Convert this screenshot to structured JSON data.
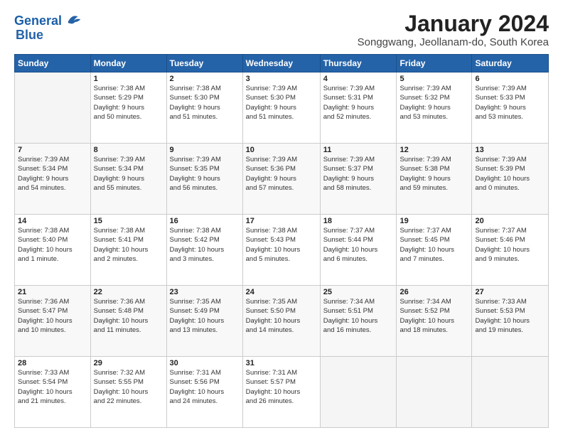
{
  "header": {
    "logo_line1": "General",
    "logo_line2": "Blue",
    "title": "January 2024",
    "subtitle": "Songgwang, Jeollanam-do, South Korea"
  },
  "days_of_week": [
    "Sunday",
    "Monday",
    "Tuesday",
    "Wednesday",
    "Thursday",
    "Friday",
    "Saturday"
  ],
  "weeks": [
    [
      {
        "day": "",
        "info": ""
      },
      {
        "day": "1",
        "info": "Sunrise: 7:38 AM\nSunset: 5:29 PM\nDaylight: 9 hours\nand 50 minutes."
      },
      {
        "day": "2",
        "info": "Sunrise: 7:38 AM\nSunset: 5:30 PM\nDaylight: 9 hours\nand 51 minutes."
      },
      {
        "day": "3",
        "info": "Sunrise: 7:39 AM\nSunset: 5:30 PM\nDaylight: 9 hours\nand 51 minutes."
      },
      {
        "day": "4",
        "info": "Sunrise: 7:39 AM\nSunset: 5:31 PM\nDaylight: 9 hours\nand 52 minutes."
      },
      {
        "day": "5",
        "info": "Sunrise: 7:39 AM\nSunset: 5:32 PM\nDaylight: 9 hours\nand 53 minutes."
      },
      {
        "day": "6",
        "info": "Sunrise: 7:39 AM\nSunset: 5:33 PM\nDaylight: 9 hours\nand 53 minutes."
      }
    ],
    [
      {
        "day": "7",
        "info": "Sunrise: 7:39 AM\nSunset: 5:34 PM\nDaylight: 9 hours\nand 54 minutes."
      },
      {
        "day": "8",
        "info": "Sunrise: 7:39 AM\nSunset: 5:34 PM\nDaylight: 9 hours\nand 55 minutes."
      },
      {
        "day": "9",
        "info": "Sunrise: 7:39 AM\nSunset: 5:35 PM\nDaylight: 9 hours\nand 56 minutes."
      },
      {
        "day": "10",
        "info": "Sunrise: 7:39 AM\nSunset: 5:36 PM\nDaylight: 9 hours\nand 57 minutes."
      },
      {
        "day": "11",
        "info": "Sunrise: 7:39 AM\nSunset: 5:37 PM\nDaylight: 9 hours\nand 58 minutes."
      },
      {
        "day": "12",
        "info": "Sunrise: 7:39 AM\nSunset: 5:38 PM\nDaylight: 9 hours\nand 59 minutes."
      },
      {
        "day": "13",
        "info": "Sunrise: 7:39 AM\nSunset: 5:39 PM\nDaylight: 10 hours\nand 0 minutes."
      }
    ],
    [
      {
        "day": "14",
        "info": "Sunrise: 7:38 AM\nSunset: 5:40 PM\nDaylight: 10 hours\nand 1 minute."
      },
      {
        "day": "15",
        "info": "Sunrise: 7:38 AM\nSunset: 5:41 PM\nDaylight: 10 hours\nand 2 minutes."
      },
      {
        "day": "16",
        "info": "Sunrise: 7:38 AM\nSunset: 5:42 PM\nDaylight: 10 hours\nand 3 minutes."
      },
      {
        "day": "17",
        "info": "Sunrise: 7:38 AM\nSunset: 5:43 PM\nDaylight: 10 hours\nand 5 minutes."
      },
      {
        "day": "18",
        "info": "Sunrise: 7:37 AM\nSunset: 5:44 PM\nDaylight: 10 hours\nand 6 minutes."
      },
      {
        "day": "19",
        "info": "Sunrise: 7:37 AM\nSunset: 5:45 PM\nDaylight: 10 hours\nand 7 minutes."
      },
      {
        "day": "20",
        "info": "Sunrise: 7:37 AM\nSunset: 5:46 PM\nDaylight: 10 hours\nand 9 minutes."
      }
    ],
    [
      {
        "day": "21",
        "info": "Sunrise: 7:36 AM\nSunset: 5:47 PM\nDaylight: 10 hours\nand 10 minutes."
      },
      {
        "day": "22",
        "info": "Sunrise: 7:36 AM\nSunset: 5:48 PM\nDaylight: 10 hours\nand 11 minutes."
      },
      {
        "day": "23",
        "info": "Sunrise: 7:35 AM\nSunset: 5:49 PM\nDaylight: 10 hours\nand 13 minutes."
      },
      {
        "day": "24",
        "info": "Sunrise: 7:35 AM\nSunset: 5:50 PM\nDaylight: 10 hours\nand 14 minutes."
      },
      {
        "day": "25",
        "info": "Sunrise: 7:34 AM\nSunset: 5:51 PM\nDaylight: 10 hours\nand 16 minutes."
      },
      {
        "day": "26",
        "info": "Sunrise: 7:34 AM\nSunset: 5:52 PM\nDaylight: 10 hours\nand 18 minutes."
      },
      {
        "day": "27",
        "info": "Sunrise: 7:33 AM\nSunset: 5:53 PM\nDaylight: 10 hours\nand 19 minutes."
      }
    ],
    [
      {
        "day": "28",
        "info": "Sunrise: 7:33 AM\nSunset: 5:54 PM\nDaylight: 10 hours\nand 21 minutes."
      },
      {
        "day": "29",
        "info": "Sunrise: 7:32 AM\nSunset: 5:55 PM\nDaylight: 10 hours\nand 22 minutes."
      },
      {
        "day": "30",
        "info": "Sunrise: 7:31 AM\nSunset: 5:56 PM\nDaylight: 10 hours\nand 24 minutes."
      },
      {
        "day": "31",
        "info": "Sunrise: 7:31 AM\nSunset: 5:57 PM\nDaylight: 10 hours\nand 26 minutes."
      },
      {
        "day": "",
        "info": ""
      },
      {
        "day": "",
        "info": ""
      },
      {
        "day": "",
        "info": ""
      }
    ]
  ]
}
